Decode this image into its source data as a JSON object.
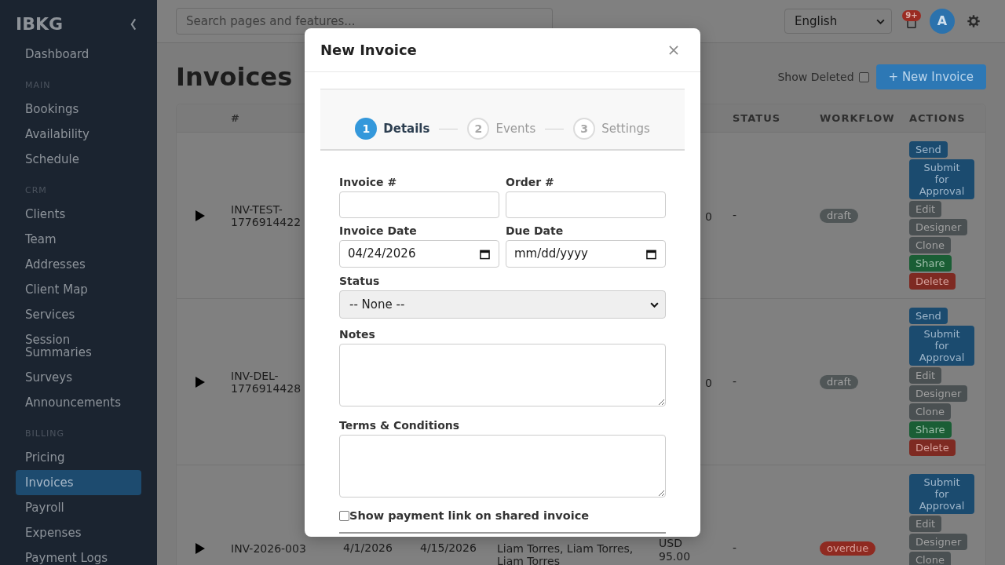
{
  "sidebar": {
    "brand": "IBKG",
    "sections": [
      {
        "items": [
          {
            "label": "Dashboard",
            "selected": false
          }
        ]
      },
      {
        "title": "MAIN",
        "items": [
          {
            "label": "Bookings",
            "selected": false
          },
          {
            "label": "Availability",
            "selected": false
          },
          {
            "label": "Schedule",
            "selected": false
          }
        ]
      },
      {
        "title": "CRM",
        "items": [
          {
            "label": "Clients",
            "selected": false
          },
          {
            "label": "Team",
            "selected": false
          },
          {
            "label": "Addresses",
            "selected": false
          },
          {
            "label": "Client Map",
            "selected": false
          },
          {
            "label": "Services",
            "selected": false
          },
          {
            "label": "Session Summaries",
            "selected": false
          },
          {
            "label": "Surveys",
            "selected": false
          },
          {
            "label": "Announcements",
            "selected": false
          }
        ]
      },
      {
        "title": "BILLING",
        "items": [
          {
            "label": "Pricing",
            "selected": false
          },
          {
            "label": "Invoices",
            "selected": true
          },
          {
            "label": "Payroll",
            "selected": false
          },
          {
            "label": "Expenses",
            "selected": false
          },
          {
            "label": "Payment Logs",
            "selected": false
          }
        ]
      }
    ]
  },
  "topbar": {
    "search": {
      "placeholder": "Search pages and features..."
    },
    "language": {
      "value": "English"
    },
    "notifications": {
      "badge": "9+"
    },
    "avatar": {
      "initial": "A"
    }
  },
  "page": {
    "title": "Invoices",
    "show_deleted": {
      "label": "Show Deleted",
      "checked": false
    },
    "new_button": "+ New Invoice"
  },
  "table": {
    "columns": [
      "#",
      "STATUS",
      "WORKFLOW",
      "ACTIONS"
    ],
    "rows": [
      {
        "expanded": false,
        "number": "INV-TEST-1776914422",
        "column_6": "0",
        "status": "-",
        "workflow": {
          "label": "draft",
          "kind": "draft"
        },
        "actions": [
          {
            "label": "Send",
            "kind": "primary"
          },
          {
            "label": "Submit for Approval",
            "kind": "primary"
          },
          {
            "label": "Edit",
            "kind": "secondary"
          },
          {
            "label": "Designer",
            "kind": "secondary"
          },
          {
            "label": "Clone",
            "kind": "secondary"
          },
          {
            "label": "Share",
            "kind": "success"
          },
          {
            "label": "Delete",
            "kind": "danger"
          }
        ]
      },
      {
        "expanded": false,
        "number": "INV-DEL-1776914428",
        "column_6": "0",
        "status": "-",
        "workflow": {
          "label": "draft",
          "kind": "draft"
        },
        "actions": [
          {
            "label": "Send",
            "kind": "primary"
          },
          {
            "label": "Submit for Approval",
            "kind": "primary"
          },
          {
            "label": "Edit",
            "kind": "secondary"
          },
          {
            "label": "Designer",
            "kind": "secondary"
          },
          {
            "label": "Clone",
            "kind": "secondary"
          },
          {
            "label": "Share",
            "kind": "success"
          },
          {
            "label": "Delete",
            "kind": "danger"
          }
        ]
      },
      {
        "expanded": false,
        "number": "INV-2026-003",
        "column_3": "4/1/2026",
        "column_4": "4/15/2026",
        "column_5": "Liam Torres, Liam Torres, Liam Torres",
        "column_6": "USD 95.00",
        "status": "-",
        "workflow": {
          "label": "overdue",
          "kind": "overdue"
        },
        "actions": [
          {
            "label": "Submit for Approval",
            "kind": "primary"
          },
          {
            "label": "Edit",
            "kind": "secondary"
          },
          {
            "label": "Designer",
            "kind": "secondary"
          },
          {
            "label": "Clone",
            "kind": "secondary"
          }
        ]
      }
    ]
  },
  "modal": {
    "title": "New Invoice",
    "steps": [
      {
        "number": "1",
        "label": "Details",
        "selected": true
      },
      {
        "number": "2",
        "label": "Events",
        "selected": false
      },
      {
        "number": "3",
        "label": "Settings",
        "selected": false
      }
    ],
    "form_rows": [
      [
        {
          "kind": "text",
          "label": "Invoice #"
        },
        {
          "kind": "text",
          "label": "Order #"
        }
      ],
      [
        {
          "kind": "date",
          "label": "Invoice Date",
          "value": "04/24/2026"
        },
        {
          "kind": "date",
          "label": "Due Date",
          "placeholder": "mm/dd/yyyy"
        }
      ],
      [
        {
          "kind": "select",
          "label": "Status",
          "value": "-- None --"
        }
      ],
      [
        {
          "kind": "textarea",
          "label": "Notes"
        }
      ],
      [
        {
          "kind": "textarea",
          "label": "Terms & Conditions"
        }
      ],
      [
        {
          "kind": "checkbox",
          "label": "Show payment link on shared invoice",
          "checked": false
        }
      ]
    ]
  }
}
